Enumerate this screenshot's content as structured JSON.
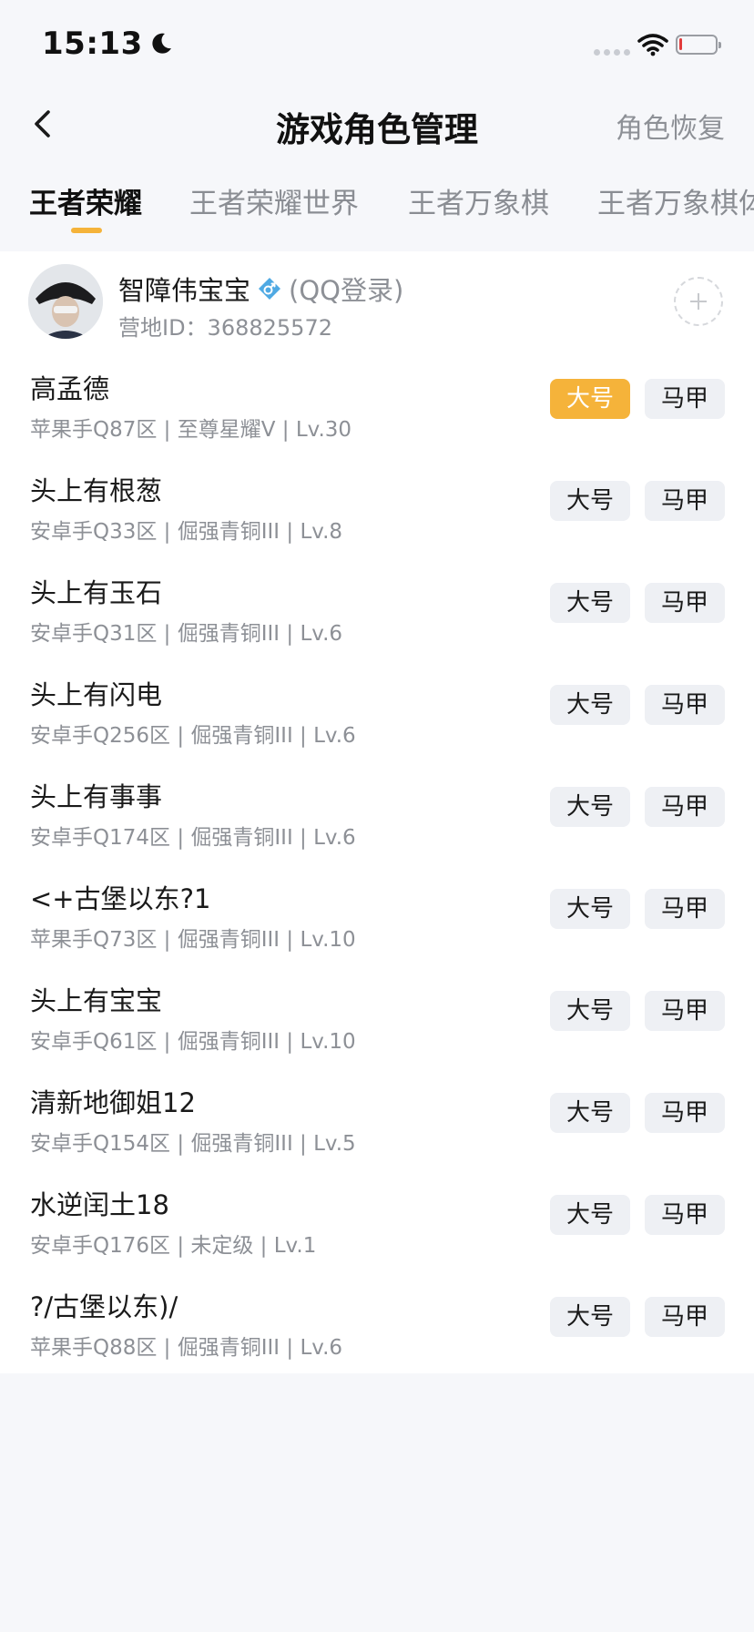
{
  "status_bar": {
    "time": "15:13"
  },
  "nav": {
    "title": "游戏角色管理",
    "restore_label": "角色恢复"
  },
  "tabs": [
    {
      "label": "王者荣耀",
      "active": true
    },
    {
      "label": "王者荣耀世界",
      "active": false
    },
    {
      "label": "王者万象棋",
      "active": false
    },
    {
      "label": "王者万象棋体",
      "active": false
    }
  ],
  "profile": {
    "name": "智障伟宝宝",
    "login_type": "(QQ登录)",
    "camp_id": "营地ID：368825572"
  },
  "roles": [
    {
      "name": "高孟德",
      "meta": "苹果手Q87区 | 至尊星耀V | Lv.30",
      "main_label": "大号",
      "alt_label": "马甲",
      "is_main": true
    },
    {
      "name": "头上有根葱",
      "meta": "安卓手Q33区 | 倔强青铜III | Lv.8",
      "main_label": "大号",
      "alt_label": "马甲",
      "is_main": false
    },
    {
      "name": "头上有玉石",
      "meta": "安卓手Q31区 | 倔强青铜III | Lv.6",
      "main_label": "大号",
      "alt_label": "马甲",
      "is_main": false
    },
    {
      "name": "头上有闪电",
      "meta": "安卓手Q256区 | 倔强青铜III | Lv.6",
      "main_label": "大号",
      "alt_label": "马甲",
      "is_main": false
    },
    {
      "name": "头上有事事",
      "meta": "安卓手Q174区 | 倔强青铜III | Lv.6",
      "main_label": "大号",
      "alt_label": "马甲",
      "is_main": false
    },
    {
      "name": "<+古堡以东?1",
      "meta": "苹果手Q73区 | 倔强青铜III | Lv.10",
      "main_label": "大号",
      "alt_label": "马甲",
      "is_main": false
    },
    {
      "name": "头上有宝宝",
      "meta": "安卓手Q61区 | 倔强青铜III | Lv.10",
      "main_label": "大号",
      "alt_label": "马甲",
      "is_main": false
    },
    {
      "name": "清新地御姐12",
      "meta": "安卓手Q154区 | 倔强青铜III | Lv.5",
      "main_label": "大号",
      "alt_label": "马甲",
      "is_main": false
    },
    {
      "name": "水逆闰土18",
      "meta": "安卓手Q176区 | 未定级 | Lv.1",
      "main_label": "大号",
      "alt_label": "马甲",
      "is_main": false
    },
    {
      "name": "?/古堡以东)/",
      "meta": "苹果手Q88区 | 倔强青铜III | Lv.6",
      "main_label": "大号",
      "alt_label": "马甲",
      "is_main": false
    }
  ],
  "colors": {
    "accent": "#f5b33a",
    "tag_bg": "#eef0f4",
    "page_bg": "#f6f7fa",
    "secondary_text": "#8d9096"
  },
  "icons": {
    "back": "back-chevron-icon",
    "add": "add-plus-icon",
    "gender": "male-icon",
    "dnd": "moon-icon"
  }
}
